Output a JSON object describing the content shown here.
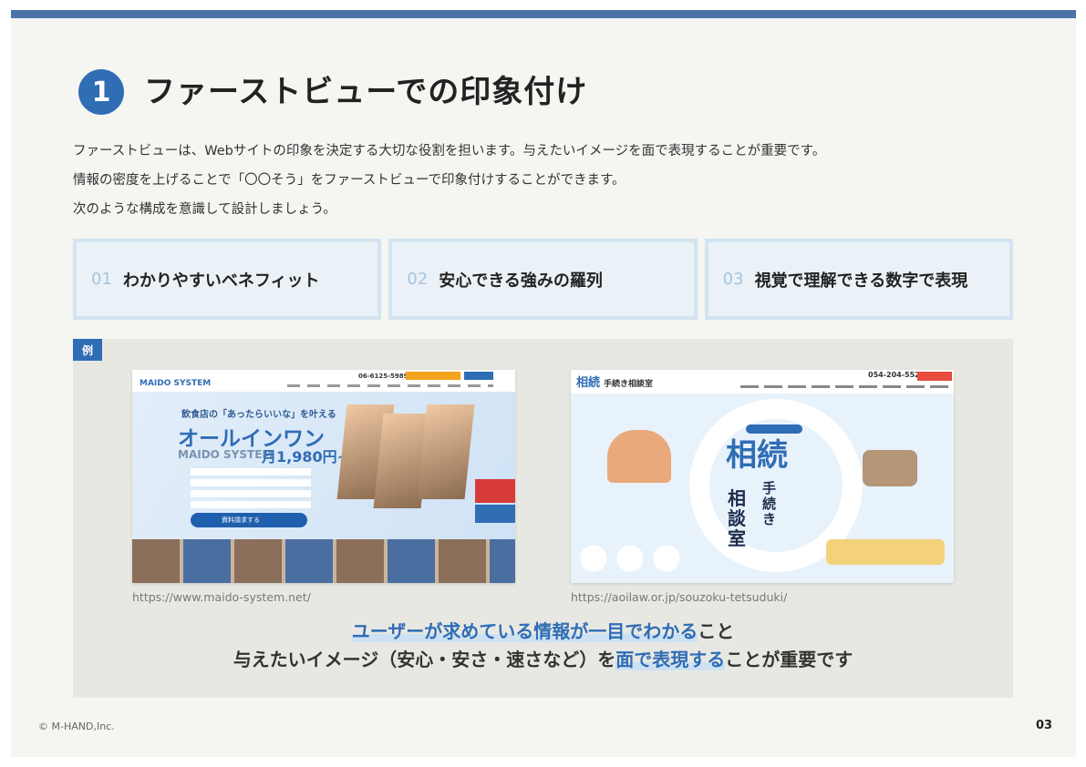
{
  "header": {
    "number": "1",
    "title": "ファーストビューでの印象付け"
  },
  "intro": {
    "line1": "ファーストビューは、Webサイトの印象を決定する大切な役割を担います。与えたいイメージを面で表現することが重要です。",
    "line2": "情報の密度を上げることで「〇〇そう」をファーストビューで印象付けすることができます。",
    "line3": "次のような構成を意識して設計しましょう。"
  },
  "points": [
    {
      "num": "01",
      "label": "わかりやすいベネフィット"
    },
    {
      "num": "02",
      "label": "安心できる強みの羅列"
    },
    {
      "num": "03",
      "label": "視覚で理解できる数字で表現"
    }
  ],
  "example": {
    "tag": "例",
    "shot1": {
      "logo": "MAIDO SYSTEM",
      "tel": "06-6125-5989",
      "subcopy": "飲食店の「あったらいいな」を叶える",
      "headline": "オールインワン",
      "brand": "MAIDO SYSTEM",
      "price": "月1,980円~",
      "cta": "資料請求する",
      "url": "https://www.maido-system.net/"
    },
    "shot2": {
      "logo": "相続",
      "name": "手続き相談室",
      "tel": "054-204-5521",
      "main": "相続",
      "sub1": "手続き",
      "sub2": "相談室",
      "url": "https://aoilaw.or.jp/souzoku-tetsuduki/"
    },
    "summary": {
      "l1_hl": "ユーザーが求めている情報が一目でわかる",
      "l1_rest": "こと",
      "l2_pre": "与えたいイメージ（安心・安さ・速さなど）を",
      "l2_hl": "面で表現する",
      "l2_rest": "ことが重要です"
    }
  },
  "footer": {
    "copyright": "© M-HAND,Inc.",
    "page": "03"
  },
  "colors": {
    "accent": "#2f6db5",
    "top_bar": "#4a72a8",
    "point_border": "#d3e4f0",
    "point_bg": "#ebf2f7"
  }
}
